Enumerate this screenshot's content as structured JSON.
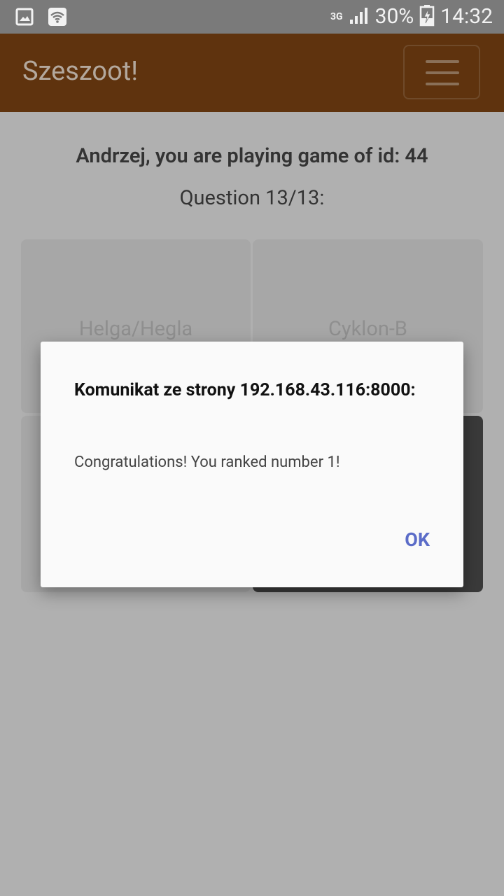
{
  "status_bar": {
    "network_type": "3G",
    "battery_percent": "30%",
    "time": "14:32",
    "icons": [
      "image-icon",
      "wifi-icon",
      "signal-icon",
      "battery-charging-icon"
    ]
  },
  "navbar": {
    "brand": "Szeszoot!",
    "menu_icon": "hamburger-menu-icon",
    "background": "#5f330e"
  },
  "game": {
    "heading": "Andrzej, you are playing game of id: 44",
    "question": "Question 13/13:"
  },
  "answers": [
    {
      "label": "Helga/Hegla"
    },
    {
      "label": "Cyklon-B"
    },
    {
      "label": ""
    },
    {
      "label": ""
    }
  ],
  "dialog": {
    "title": "Komunikat ze strony 192.168.43.116:8000:",
    "message": "Congratulations! You ranked number 1!",
    "ok_label": "OK",
    "accent_color": "#5b6cc8"
  }
}
